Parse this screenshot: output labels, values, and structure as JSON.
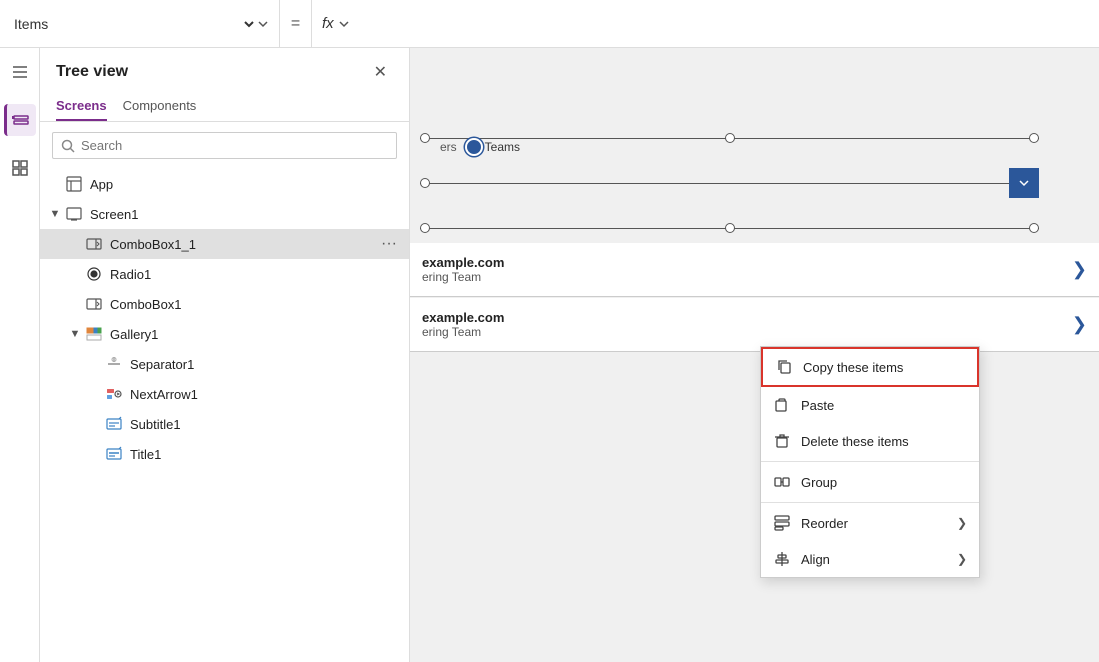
{
  "topbar": {
    "formula_select": "Items",
    "equals_symbol": "=",
    "fx_label": "fx"
  },
  "tree_panel": {
    "title": "Tree view",
    "tabs": [
      {
        "label": "Screens",
        "active": true
      },
      {
        "label": "Components",
        "active": false
      }
    ],
    "search_placeholder": "Search",
    "tree_items": [
      {
        "id": "app",
        "label": "App",
        "level": 0,
        "icon": "app-icon",
        "has_chevron": false,
        "chevron_open": false,
        "selected": false
      },
      {
        "id": "screen1",
        "label": "Screen1",
        "level": 0,
        "icon": "screen-icon",
        "has_chevron": true,
        "chevron_open": true,
        "selected": false
      },
      {
        "id": "combobox1_1",
        "label": "ComboBox1_1",
        "level": 1,
        "icon": "combobox-icon",
        "has_chevron": false,
        "chevron_open": false,
        "selected": true,
        "show_more": true
      },
      {
        "id": "radio1",
        "label": "Radio1",
        "level": 1,
        "icon": "radio-icon",
        "has_chevron": false,
        "chevron_open": false,
        "selected": false
      },
      {
        "id": "combobox1",
        "label": "ComboBox1",
        "level": 1,
        "icon": "combobox-icon",
        "has_chevron": false,
        "chevron_open": false,
        "selected": false
      },
      {
        "id": "gallery1",
        "label": "Gallery1",
        "level": 1,
        "icon": "gallery-icon",
        "has_chevron": true,
        "chevron_open": true,
        "selected": false
      },
      {
        "id": "separator1",
        "label": "Separator1",
        "level": 2,
        "icon": "separator-icon",
        "has_chevron": false,
        "chevron_open": false,
        "selected": false
      },
      {
        "id": "nextarrow1",
        "label": "NextArrow1",
        "level": 2,
        "icon": "nextarrow-icon",
        "has_chevron": false,
        "chevron_open": false,
        "selected": false
      },
      {
        "id": "subtitle1",
        "label": "Subtitle1",
        "level": 2,
        "icon": "subtitle-icon",
        "has_chevron": false,
        "chevron_open": false,
        "selected": false
      },
      {
        "id": "title1",
        "label": "Title1",
        "level": 2,
        "icon": "title-icon",
        "has_chevron": false,
        "chevron_open": false,
        "selected": false
      }
    ]
  },
  "context_menu": {
    "items": [
      {
        "id": "copy",
        "label": "Copy these items",
        "icon": "copy-icon",
        "has_arrow": false,
        "highlighted": true
      },
      {
        "id": "paste",
        "label": "Paste",
        "icon": "paste-icon",
        "has_arrow": false,
        "highlighted": false
      },
      {
        "id": "delete",
        "label": "Delete these items",
        "icon": "delete-icon",
        "has_arrow": false,
        "highlighted": false
      },
      {
        "id": "group",
        "label": "Group",
        "icon": "group-icon",
        "has_arrow": false,
        "highlighted": false
      },
      {
        "id": "reorder",
        "label": "Reorder",
        "icon": "reorder-icon",
        "has_arrow": true,
        "highlighted": false
      },
      {
        "id": "align",
        "label": "Align",
        "icon": "align-icon",
        "has_arrow": true,
        "highlighted": false
      }
    ]
  },
  "canvas": {
    "teams_label": "Teams",
    "list_items": [
      {
        "domain": "example.com",
        "sub": "ering Team"
      },
      {
        "domain": "example.com",
        "sub": "ering Team"
      }
    ]
  }
}
